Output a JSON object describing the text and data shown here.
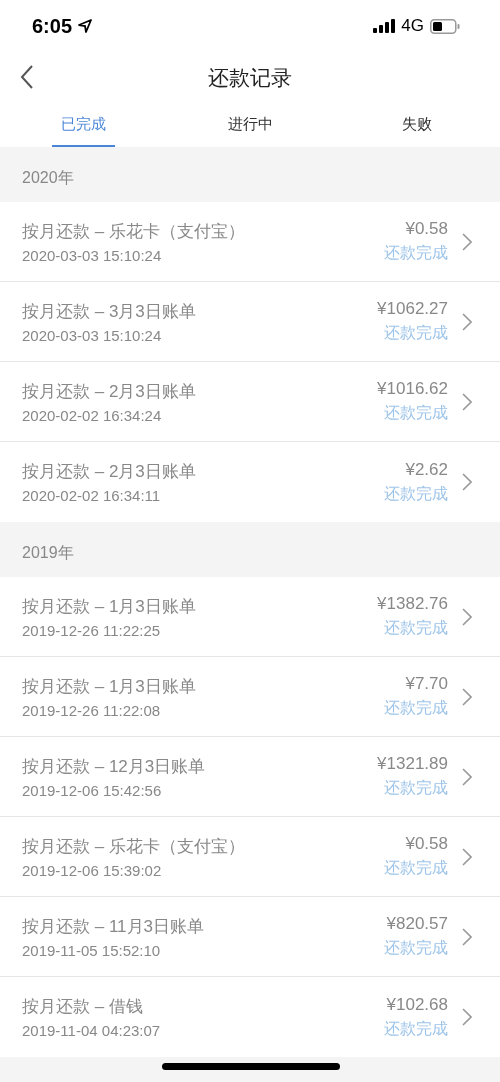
{
  "status_bar": {
    "time": "6:05",
    "network": "4G"
  },
  "header": {
    "title": "还款记录"
  },
  "tabs": [
    {
      "label": "已完成",
      "selected": true
    },
    {
      "label": "进行中",
      "selected": false
    },
    {
      "label": "失败",
      "selected": false
    }
  ],
  "sections": [
    {
      "year": "2020年",
      "rows": [
        {
          "title": "按月还款 – 乐花卡（支付宝）",
          "time": "2020-03-03 15:10:24",
          "amount": "¥0.58",
          "status": "还款完成"
        },
        {
          "title": "按月还款 – 3月3日账单",
          "time": "2020-03-03 15:10:24",
          "amount": "¥1062.27",
          "status": "还款完成"
        },
        {
          "title": "按月还款 – 2月3日账单",
          "time": "2020-02-02 16:34:24",
          "amount": "¥1016.62",
          "status": "还款完成"
        },
        {
          "title": "按月还款 – 2月3日账单",
          "time": "2020-02-02 16:34:11",
          "amount": "¥2.62",
          "status": "还款完成"
        }
      ]
    },
    {
      "year": "2019年",
      "rows": [
        {
          "title": "按月还款 – 1月3日账单",
          "time": "2019-12-26 11:22:25",
          "amount": "¥1382.76",
          "status": "还款完成"
        },
        {
          "title": "按月还款 – 1月3日账单",
          "time": "2019-12-26 11:22:08",
          "amount": "¥7.70",
          "status": "还款完成"
        },
        {
          "title": "按月还款 – 12月3日账单",
          "time": "2019-12-06 15:42:56",
          "amount": "¥1321.89",
          "status": "还款完成"
        },
        {
          "title": "按月还款 – 乐花卡（支付宝）",
          "time": "2019-12-06 15:39:02",
          "amount": "¥0.58",
          "status": "还款完成"
        },
        {
          "title": "按月还款 – 11月3日账单",
          "time": "2019-11-05 15:52:10",
          "amount": "¥820.57",
          "status": "还款完成"
        },
        {
          "title": "按月还款 – 借钱",
          "time": "2019-11-04 04:23:07",
          "amount": "¥102.68",
          "status": "还款完成"
        }
      ]
    }
  ]
}
